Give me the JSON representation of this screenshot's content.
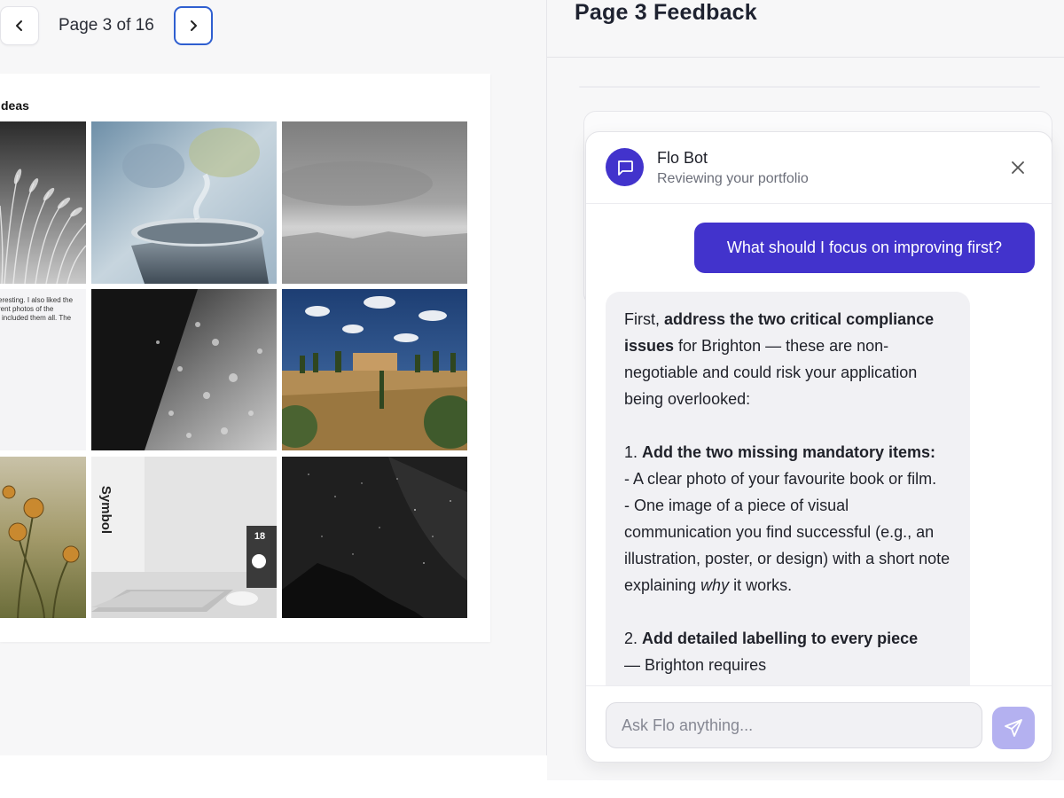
{
  "pager": {
    "page_label": "Page 3 of 16",
    "current_page": 3,
    "total_pages": 16
  },
  "document": {
    "heading": "deas",
    "note_text": "eresting. I also liked the\nrent photos of the\nl included them all. The",
    "photos": [
      {
        "name": "photo-wheat-field",
        "description_icon": "wheat-grass"
      },
      {
        "name": "photo-steaming-cup",
        "description_icon": "cup"
      },
      {
        "name": "photo-grey-sky",
        "description_icon": "sky"
      },
      {
        "name": "photo-water-droplets",
        "description_icon": "droplets"
      },
      {
        "name": "photo-tuscan-villa",
        "description_icon": "landscape"
      },
      {
        "name": "photo-thistle-flowers",
        "description_icon": "flower"
      },
      {
        "name": "photo-laptop-desk",
        "description_icon": "laptop"
      },
      {
        "name": "photo-night-sky",
        "description_icon": "stars"
      }
    ],
    "desk_photo_book_text": "Symbol",
    "desk_photo_calendar_number": "18"
  },
  "feedback": {
    "title": "Page 3 Feedback"
  },
  "chat": {
    "bot_name": "Flo Bot",
    "bot_status": "Reviewing your portfolio",
    "user_message": "What should I focus on improving first?",
    "bot_reply": {
      "p1_a": "First, ",
      "p1_b": "address the two critical compliance issues",
      "p1_c": " for Brighton — these are non-negotiable and could risk your application being overlooked:",
      "item1_title": "1. ",
      "item1_bold": "Add the two missing mandatory items:",
      "item1_line1": "- A clear photo of your favourite book or film.",
      "item1_line2_a": "- One image of a piece of visual communication you find successful (e.g., an illustration, poster, or design) with a short note explaining ",
      "item1_line2_em": "why",
      "item1_line2_b": " it works.",
      "item2_title": "2. ",
      "item2_bold": "Add detailed labelling to every piece",
      "item2_cut": "— Brighton requires"
    },
    "input_placeholder": "Ask Flo anything...",
    "accent_color": "#4233cc",
    "send_button_color": "#b4b1f0"
  }
}
